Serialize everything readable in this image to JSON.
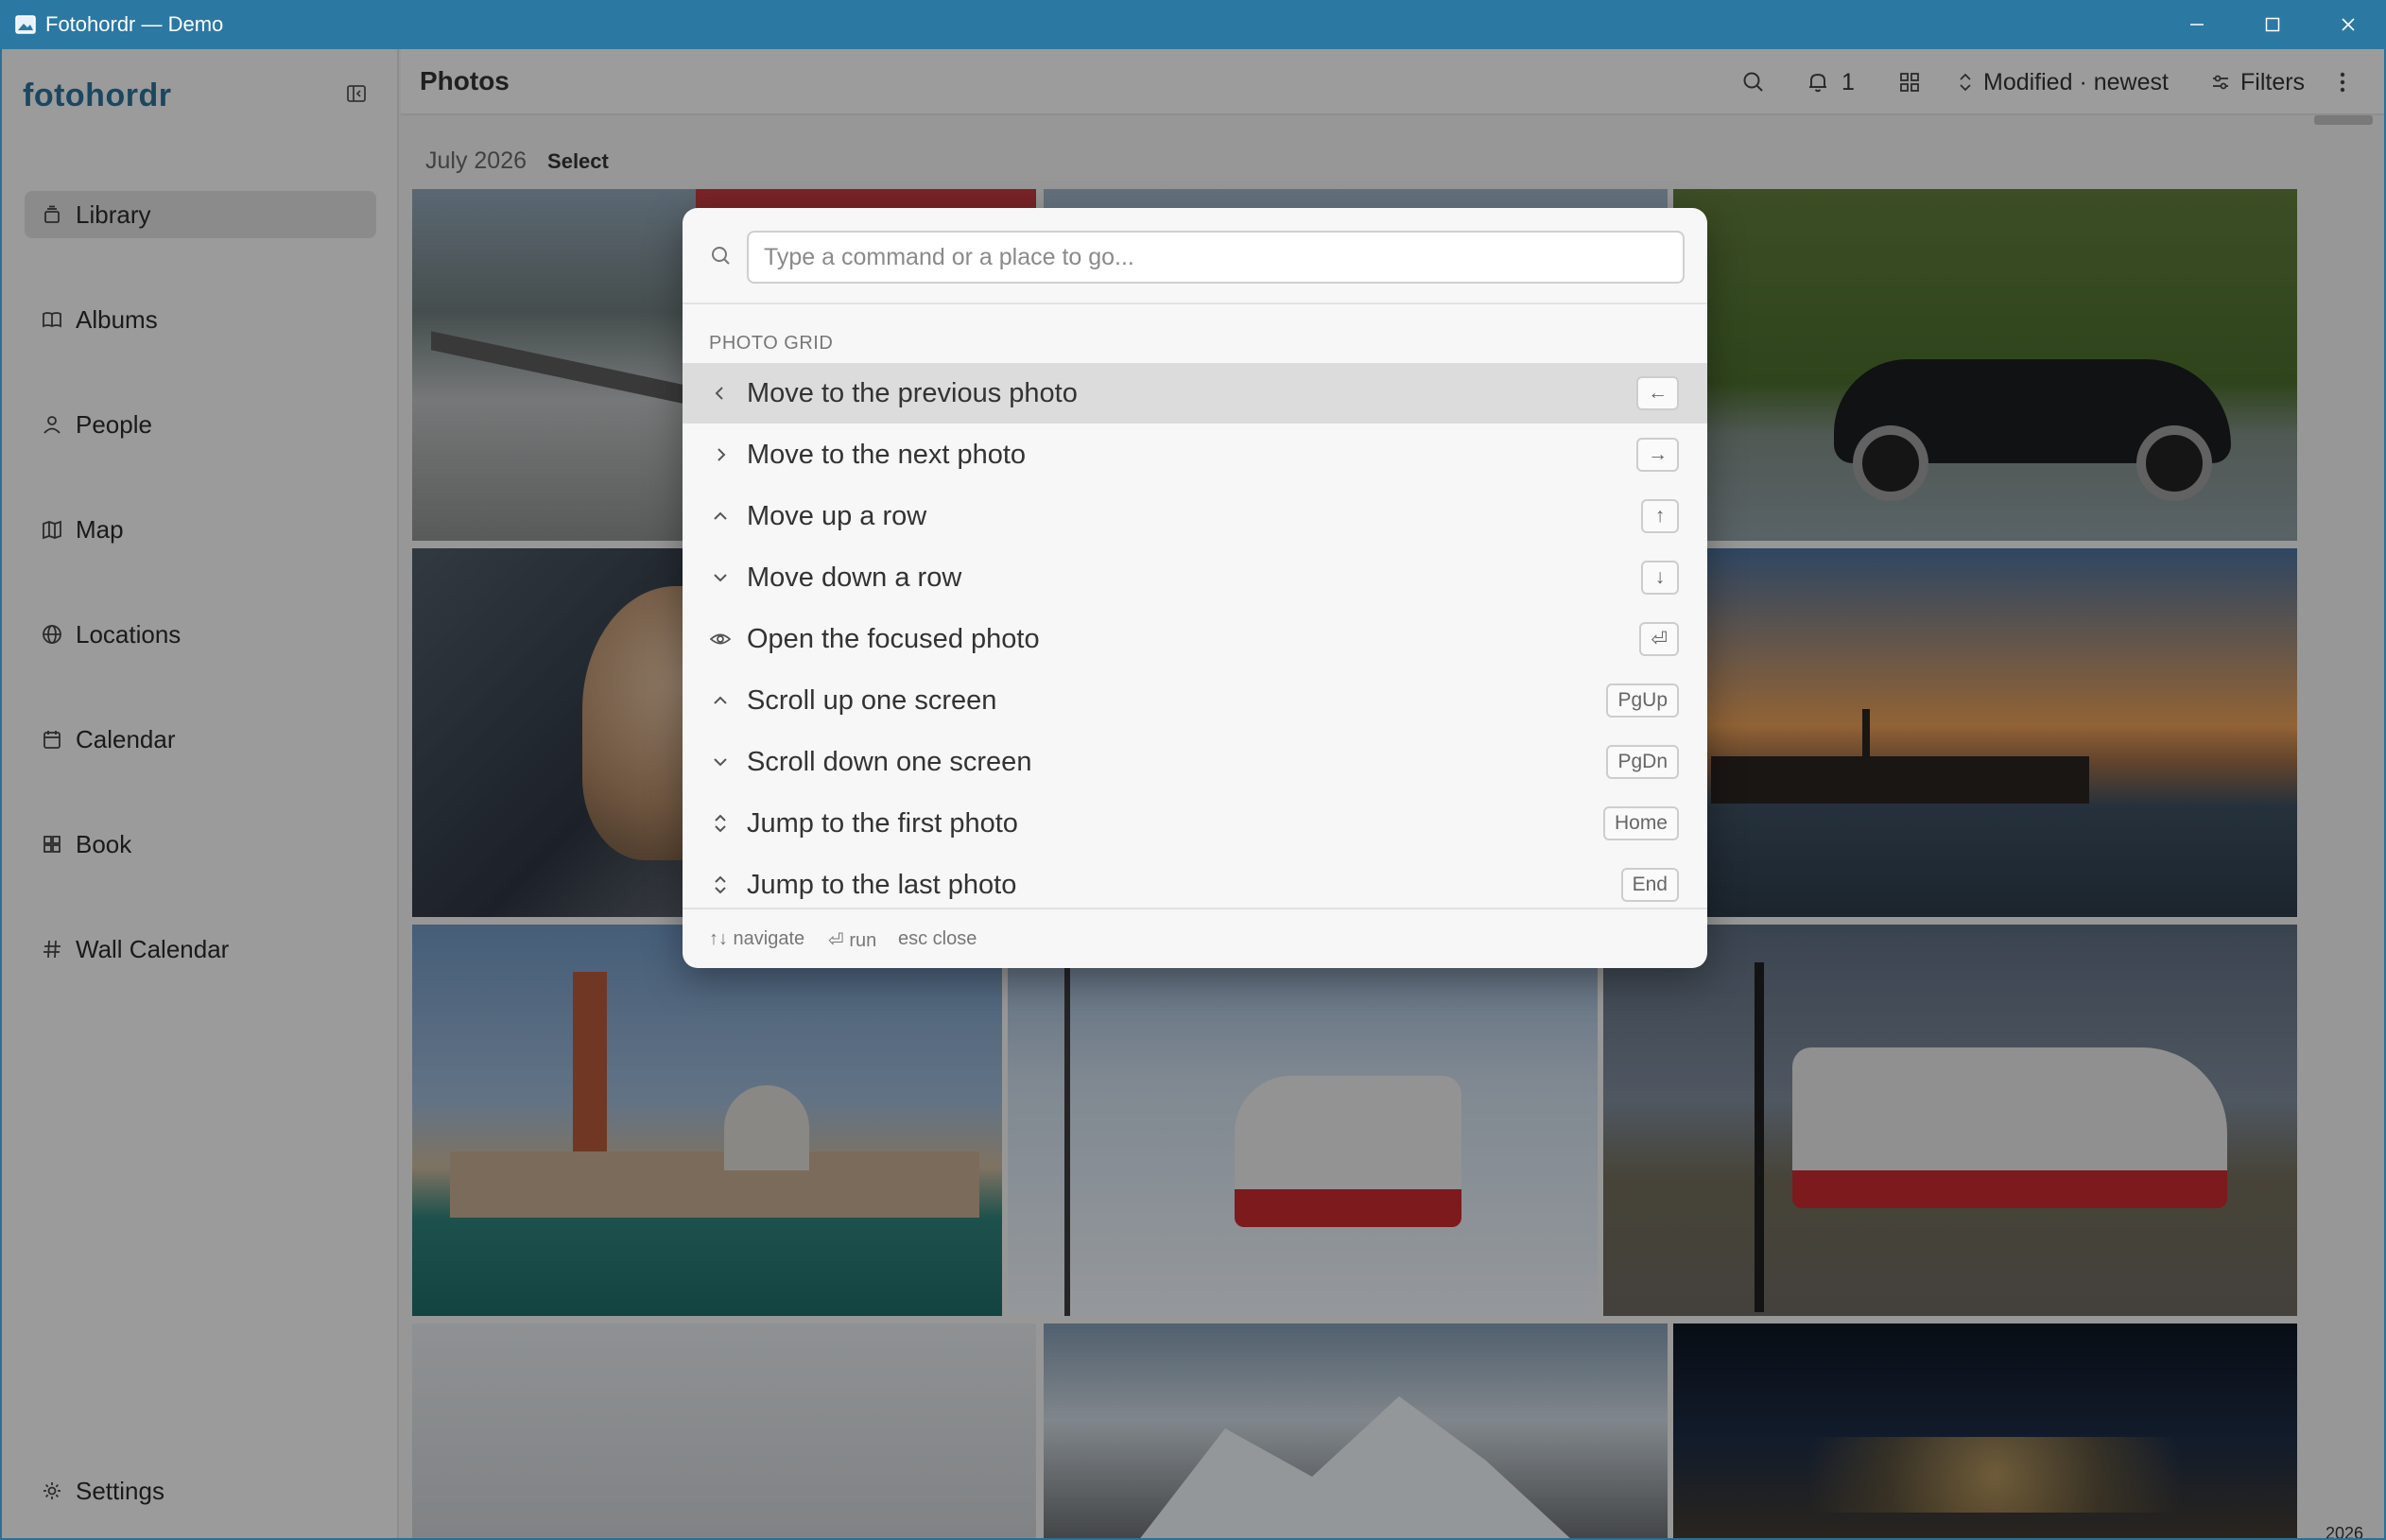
{
  "window": {
    "title": "Fotohordr — Demo",
    "icons": {
      "app": "app-photo-icon",
      "minimize": "minimize-icon",
      "maximize": "maximize-icon",
      "close": "close-icon"
    }
  },
  "sidebar": {
    "brand": "fotohordr",
    "collapse_icon": "sidebar-collapse-icon",
    "items": [
      {
        "label": "Library",
        "icon": "library-icon",
        "active": true
      },
      {
        "label": "Albums",
        "icon": "book-open-icon"
      },
      {
        "label": "People",
        "icon": "person-icon"
      },
      {
        "label": "Map",
        "icon": "map-icon"
      },
      {
        "label": "Locations",
        "icon": "globe-icon"
      },
      {
        "label": "Calendar",
        "icon": "calendar-icon"
      },
      {
        "label": "Book",
        "icon": "grid-book-icon"
      },
      {
        "label": "Wall Calendar",
        "icon": "hash-icon"
      }
    ],
    "settings": {
      "label": "Settings",
      "icon": "gear-icon"
    }
  },
  "header": {
    "title": "Photos",
    "notifications_count": "1",
    "sort_label": "Modified · newest",
    "filters_label": "Filters"
  },
  "grid": {
    "month_label": "July 2026",
    "select_label": "Select",
    "year_marker": "2026"
  },
  "palette": {
    "placeholder": "Type a command or a place to go...",
    "section": "PHOTO GRID",
    "commands": [
      {
        "label": "Move to the previous photo",
        "key": "←",
        "icon": "chevron-left-icon"
      },
      {
        "label": "Move to the next photo",
        "key": "→",
        "icon": "chevron-right-icon"
      },
      {
        "label": "Move up a row",
        "key": "↑",
        "icon": "chevron-up-icon"
      },
      {
        "label": "Move down a row",
        "key": "↓",
        "icon": "chevron-down-icon"
      },
      {
        "label": "Open the focused photo",
        "key": "⏎",
        "icon": "eye-icon"
      },
      {
        "label": "Scroll up one screen",
        "key": "PgUp",
        "icon": "chevron-up-icon"
      },
      {
        "label": "Scroll down one screen",
        "key": "PgDn",
        "icon": "chevron-down-icon"
      },
      {
        "label": "Jump to the first photo",
        "key": "Home",
        "icon": "chevrons-up-down-icon"
      },
      {
        "label": "Jump to the last photo",
        "key": "End",
        "icon": "chevrons-up-down-icon"
      }
    ],
    "footer": {
      "navigate": "↑↓ navigate",
      "run": "⏎ run",
      "close": "esc close"
    }
  },
  "colors": {
    "titlebar": "#2b78a3",
    "brand": "#2b6f96",
    "selected_row": "#dcdcdc"
  }
}
